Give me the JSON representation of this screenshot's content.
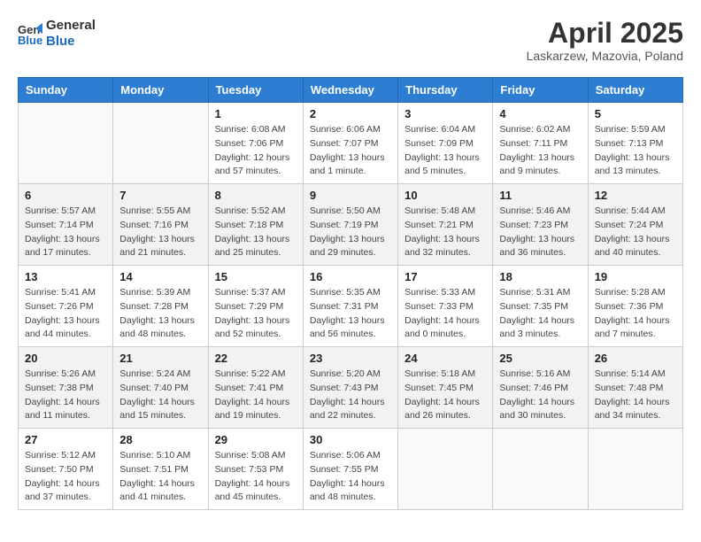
{
  "logo": {
    "line1": "General",
    "line2": "Blue"
  },
  "title": "April 2025",
  "location": "Laskarzew, Mazovia, Poland",
  "days_of_week": [
    "Sunday",
    "Monday",
    "Tuesday",
    "Wednesday",
    "Thursday",
    "Friday",
    "Saturday"
  ],
  "weeks": [
    [
      {
        "day": "",
        "info": ""
      },
      {
        "day": "",
        "info": ""
      },
      {
        "day": "1",
        "info": "Sunrise: 6:08 AM\nSunset: 7:06 PM\nDaylight: 12 hours\nand 57 minutes."
      },
      {
        "day": "2",
        "info": "Sunrise: 6:06 AM\nSunset: 7:07 PM\nDaylight: 13 hours\nand 1 minute."
      },
      {
        "day": "3",
        "info": "Sunrise: 6:04 AM\nSunset: 7:09 PM\nDaylight: 13 hours\nand 5 minutes."
      },
      {
        "day": "4",
        "info": "Sunrise: 6:02 AM\nSunset: 7:11 PM\nDaylight: 13 hours\nand 9 minutes."
      },
      {
        "day": "5",
        "info": "Sunrise: 5:59 AM\nSunset: 7:13 PM\nDaylight: 13 hours\nand 13 minutes."
      }
    ],
    [
      {
        "day": "6",
        "info": "Sunrise: 5:57 AM\nSunset: 7:14 PM\nDaylight: 13 hours\nand 17 minutes."
      },
      {
        "day": "7",
        "info": "Sunrise: 5:55 AM\nSunset: 7:16 PM\nDaylight: 13 hours\nand 21 minutes."
      },
      {
        "day": "8",
        "info": "Sunrise: 5:52 AM\nSunset: 7:18 PM\nDaylight: 13 hours\nand 25 minutes."
      },
      {
        "day": "9",
        "info": "Sunrise: 5:50 AM\nSunset: 7:19 PM\nDaylight: 13 hours\nand 29 minutes."
      },
      {
        "day": "10",
        "info": "Sunrise: 5:48 AM\nSunset: 7:21 PM\nDaylight: 13 hours\nand 32 minutes."
      },
      {
        "day": "11",
        "info": "Sunrise: 5:46 AM\nSunset: 7:23 PM\nDaylight: 13 hours\nand 36 minutes."
      },
      {
        "day": "12",
        "info": "Sunrise: 5:44 AM\nSunset: 7:24 PM\nDaylight: 13 hours\nand 40 minutes."
      }
    ],
    [
      {
        "day": "13",
        "info": "Sunrise: 5:41 AM\nSunset: 7:26 PM\nDaylight: 13 hours\nand 44 minutes."
      },
      {
        "day": "14",
        "info": "Sunrise: 5:39 AM\nSunset: 7:28 PM\nDaylight: 13 hours\nand 48 minutes."
      },
      {
        "day": "15",
        "info": "Sunrise: 5:37 AM\nSunset: 7:29 PM\nDaylight: 13 hours\nand 52 minutes."
      },
      {
        "day": "16",
        "info": "Sunrise: 5:35 AM\nSunset: 7:31 PM\nDaylight: 13 hours\nand 56 minutes."
      },
      {
        "day": "17",
        "info": "Sunrise: 5:33 AM\nSunset: 7:33 PM\nDaylight: 14 hours\nand 0 minutes."
      },
      {
        "day": "18",
        "info": "Sunrise: 5:31 AM\nSunset: 7:35 PM\nDaylight: 14 hours\nand 3 minutes."
      },
      {
        "day": "19",
        "info": "Sunrise: 5:28 AM\nSunset: 7:36 PM\nDaylight: 14 hours\nand 7 minutes."
      }
    ],
    [
      {
        "day": "20",
        "info": "Sunrise: 5:26 AM\nSunset: 7:38 PM\nDaylight: 14 hours\nand 11 minutes."
      },
      {
        "day": "21",
        "info": "Sunrise: 5:24 AM\nSunset: 7:40 PM\nDaylight: 14 hours\nand 15 minutes."
      },
      {
        "day": "22",
        "info": "Sunrise: 5:22 AM\nSunset: 7:41 PM\nDaylight: 14 hours\nand 19 minutes."
      },
      {
        "day": "23",
        "info": "Sunrise: 5:20 AM\nSunset: 7:43 PM\nDaylight: 14 hours\nand 22 minutes."
      },
      {
        "day": "24",
        "info": "Sunrise: 5:18 AM\nSunset: 7:45 PM\nDaylight: 14 hours\nand 26 minutes."
      },
      {
        "day": "25",
        "info": "Sunrise: 5:16 AM\nSunset: 7:46 PM\nDaylight: 14 hours\nand 30 minutes."
      },
      {
        "day": "26",
        "info": "Sunrise: 5:14 AM\nSunset: 7:48 PM\nDaylight: 14 hours\nand 34 minutes."
      }
    ],
    [
      {
        "day": "27",
        "info": "Sunrise: 5:12 AM\nSunset: 7:50 PM\nDaylight: 14 hours\nand 37 minutes."
      },
      {
        "day": "28",
        "info": "Sunrise: 5:10 AM\nSunset: 7:51 PM\nDaylight: 14 hours\nand 41 minutes."
      },
      {
        "day": "29",
        "info": "Sunrise: 5:08 AM\nSunset: 7:53 PM\nDaylight: 14 hours\nand 45 minutes."
      },
      {
        "day": "30",
        "info": "Sunrise: 5:06 AM\nSunset: 7:55 PM\nDaylight: 14 hours\nand 48 minutes."
      },
      {
        "day": "",
        "info": ""
      },
      {
        "day": "",
        "info": ""
      },
      {
        "day": "",
        "info": ""
      }
    ]
  ]
}
